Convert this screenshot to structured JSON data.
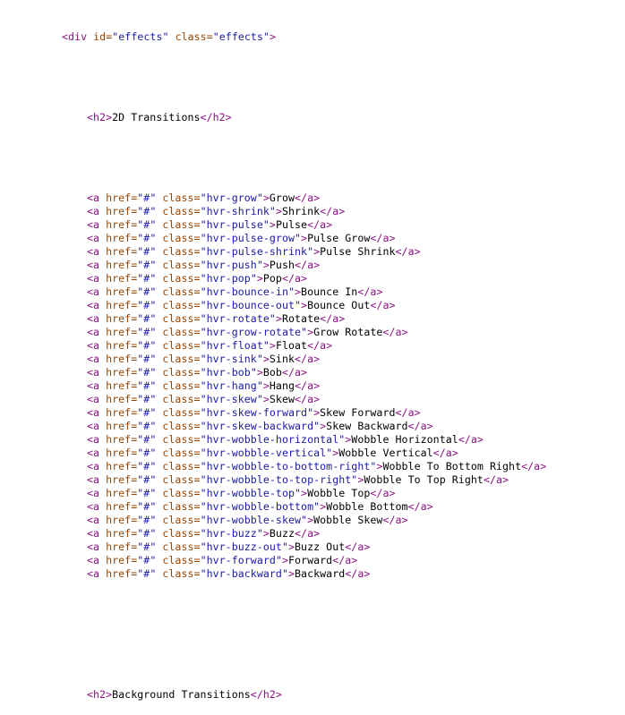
{
  "colors": {
    "tag": "#881280",
    "attribute": "#994500",
    "value": "#1a1aa6",
    "text": "#000000"
  },
  "code": {
    "div_open": {
      "tag": "div",
      "id": "effects",
      "class": "effects"
    },
    "section_1_heading": "2D Transitions",
    "links": [
      {
        "href": "#",
        "class": "hvr-grow",
        "text": "Grow"
      },
      {
        "href": "#",
        "class": "hvr-shrink",
        "text": "Shrink"
      },
      {
        "href": "#",
        "class": "hvr-pulse",
        "text": "Pulse"
      },
      {
        "href": "#",
        "class": "hvr-pulse-grow",
        "text": "Pulse Grow"
      },
      {
        "href": "#",
        "class": "hvr-pulse-shrink",
        "text": "Pulse Shrink"
      },
      {
        "href": "#",
        "class": "hvr-push",
        "text": "Push"
      },
      {
        "href": "#",
        "class": "hvr-pop",
        "text": "Pop"
      },
      {
        "href": "#",
        "class": "hvr-bounce-in",
        "text": "Bounce In"
      },
      {
        "href": "#",
        "class": "hvr-bounce-out",
        "text": "Bounce Out"
      },
      {
        "href": "#",
        "class": "hvr-rotate",
        "text": "Rotate"
      },
      {
        "href": "#",
        "class": "hvr-grow-rotate",
        "text": "Grow Rotate"
      },
      {
        "href": "#",
        "class": "hvr-float",
        "text": "Float"
      },
      {
        "href": "#",
        "class": "hvr-sink",
        "text": "Sink"
      },
      {
        "href": "#",
        "class": "hvr-bob",
        "text": "Bob"
      },
      {
        "href": "#",
        "class": "hvr-hang",
        "text": "Hang"
      },
      {
        "href": "#",
        "class": "hvr-skew",
        "text": "Skew"
      },
      {
        "href": "#",
        "class": "hvr-skew-forward",
        "text": "Skew Forward"
      },
      {
        "href": "#",
        "class": "hvr-skew-backward",
        "text": "Skew Backward"
      },
      {
        "href": "#",
        "class": "hvr-wobble-horizontal",
        "text": "Wobble Horizontal"
      },
      {
        "href": "#",
        "class": "hvr-wobble-vertical",
        "text": "Wobble Vertical"
      },
      {
        "href": "#",
        "class": "hvr-wobble-to-bottom-right",
        "text": "Wobble To Bottom Right"
      },
      {
        "href": "#",
        "class": "hvr-wobble-to-top-right",
        "text": "Wobble To Top Right"
      },
      {
        "href": "#",
        "class": "hvr-wobble-top",
        "text": "Wobble Top"
      },
      {
        "href": "#",
        "class": "hvr-wobble-bottom",
        "text": "Wobble Bottom"
      },
      {
        "href": "#",
        "class": "hvr-wobble-skew",
        "text": "Wobble Skew"
      },
      {
        "href": "#",
        "class": "hvr-buzz",
        "text": "Buzz"
      },
      {
        "href": "#",
        "class": "hvr-buzz-out",
        "text": "Buzz Out"
      },
      {
        "href": "#",
        "class": "hvr-forward",
        "text": "Forward"
      },
      {
        "href": "#",
        "class": "hvr-backward",
        "text": "Backward"
      }
    ],
    "section_2_heading": "Background Transitions"
  }
}
